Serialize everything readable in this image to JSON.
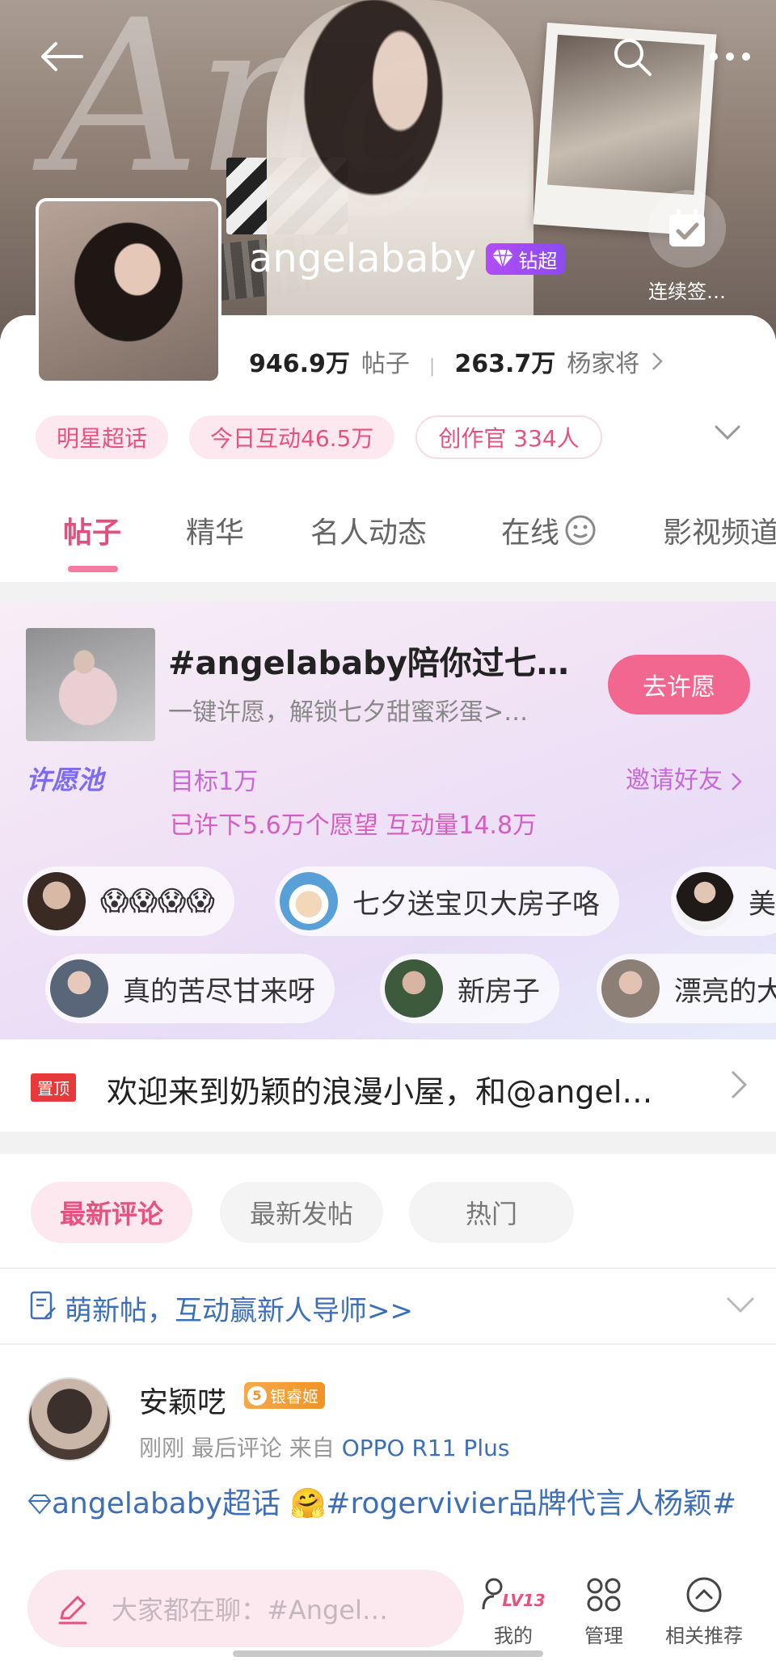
{
  "header": {
    "title": "angelababy",
    "badge_label": "钻超",
    "checkin_label": "连续签…"
  },
  "stats": {
    "posts_value": "946.9万",
    "posts_label": "帖子",
    "fans_value": "263.7万",
    "fans_label": "杨家将"
  },
  "tags": [
    "明星超话",
    "今日互动46.5万",
    "创作官 334人"
  ],
  "tabs": [
    "帖子",
    "精华",
    "名人动态",
    "在线",
    "影视频道"
  ],
  "wish_pool": {
    "title": "#angelababy陪你过七…",
    "subtitle": "一键许愿，解锁七夕甜蜜彩蛋>…",
    "button": "去许愿",
    "logo": "许愿池",
    "target": "目标1万",
    "invite": "邀请好友",
    "progress": "已许下5.6万个愿望 互动量14.8万",
    "chips_row1": [
      "😱😱😱😱",
      "七夕送宝贝大房子咯",
      "美"
    ],
    "chips_row2": [
      "真的苦尽甘来呀",
      "新房子",
      "漂亮的大"
    ]
  },
  "pinned": {
    "badge": "置顶",
    "text": "欢迎来到奶颖的浪漫小屋，和@angel…"
  },
  "sort": [
    "最新评论",
    "最新发帖",
    "热门"
  ],
  "newbie": {
    "text": "萌新帖，互动赢新人导师>>"
  },
  "post": {
    "author": "安颖呓",
    "badge_level": "5",
    "badge_text": "银睿姬",
    "meta_prefix": "刚刚 最后评论  来自 ",
    "device": "OPPO R11 Plus",
    "content": "angelababy超话 🤗#rogervivier品牌代言人杨颖#"
  },
  "bottom_bar": {
    "compose_placeholder": "大家都在聊：#Angel…",
    "mine_label": "我的",
    "mine_level": "LV13",
    "manage_label": "管理",
    "related_label": "相关推荐"
  },
  "colors": {
    "accent_pink": "#e5527f",
    "link_blue": "#3c6fb8",
    "wish_button": "#f2678f"
  }
}
